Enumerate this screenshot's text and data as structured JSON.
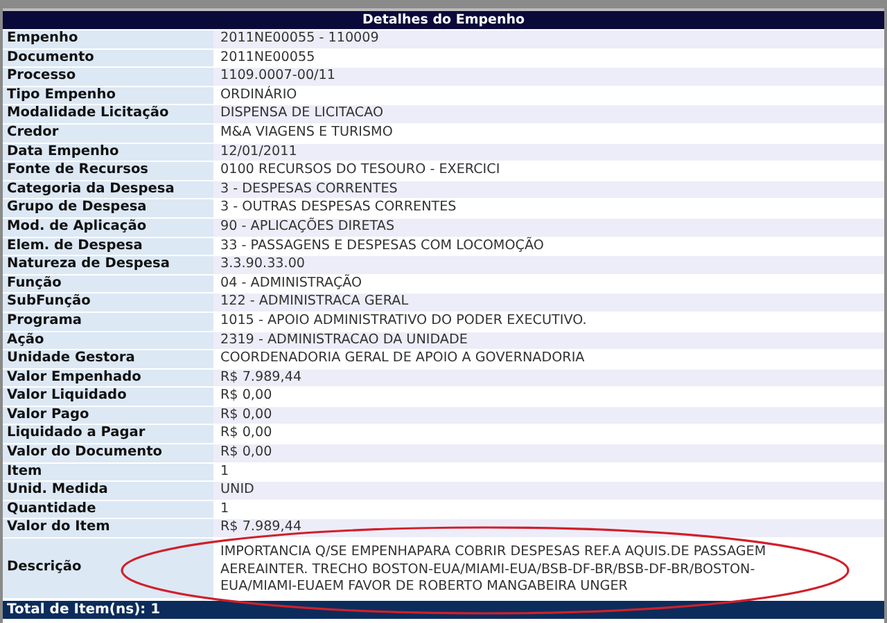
{
  "title": "Detalhes do Empenho",
  "rows": [
    {
      "label": "Empenho",
      "value": "2011NE00055 - 110009"
    },
    {
      "label": "Documento",
      "value": "2011NE00055"
    },
    {
      "label": "Processo",
      "value": "1109.0007-00/11"
    },
    {
      "label": "Tipo Empenho",
      "value": "ORDINÁRIO"
    },
    {
      "label": "Modalidade Licitação",
      "value": "DISPENSA DE LICITACAO"
    },
    {
      "label": "Credor",
      "value": "M&A VIAGENS E TURISMO"
    },
    {
      "label": "Data Empenho",
      "value": "12/01/2011"
    },
    {
      "label": "Fonte de Recursos",
      "value": "0100 RECURSOS DO TESOURO - EXERCICI"
    },
    {
      "label": "Categoria da Despesa",
      "value": "3 - DESPESAS CORRENTES"
    },
    {
      "label": "Grupo de Despesa",
      "value": "3 - OUTRAS DESPESAS CORRENTES"
    },
    {
      "label": "Mod. de Aplicação",
      "value": "90 - APLICAÇÕES DIRETAS"
    },
    {
      "label": "Elem. de Despesa",
      "value": "33 - PASSAGENS E DESPESAS COM LOCOMOÇÃO"
    },
    {
      "label": "Natureza de Despesa",
      "value": "3.3.90.33.00"
    },
    {
      "label": "Função",
      "value": "04 - ADMINISTRAÇÃO"
    },
    {
      "label": "SubFunção",
      "value": "122 - ADMINISTRACA GERAL"
    },
    {
      "label": "Programa",
      "value": "1015 - APOIO ADMINISTRATIVO DO PODER EXECUTIVO."
    },
    {
      "label": "Ação",
      "value": "2319 - ADMINISTRACAO DA UNIDADE"
    },
    {
      "label": "Unidade Gestora",
      "value": "COORDENADORIA GERAL DE APOIO A GOVERNADORIA"
    },
    {
      "label": "Valor Empenhado",
      "value": "R$ 7.989,44"
    },
    {
      "label": "Valor Liquidado",
      "value": "R$ 0,00"
    },
    {
      "label": "Valor Pago",
      "value": "R$ 0,00"
    },
    {
      "label": "Liquidado a Pagar",
      "value": "R$ 0,00"
    },
    {
      "label": "Valor do Documento",
      "value": "R$ 0,00"
    },
    {
      "label": "Item",
      "value": "1"
    },
    {
      "label": "Unid. Medida",
      "value": "UNID"
    },
    {
      "label": "Quantidade",
      "value": "1"
    },
    {
      "label": "Valor do Item",
      "value": "R$ 7.989,44"
    },
    {
      "label": "Descrição",
      "value": "IMPORTANCIA Q/SE EMPENHAPARA COBRIR DESPESAS REF.A AQUIS.DE PASSAGEM AEREAINTER. TRECHO BOSTON-EUA/MIAMI-EUA/BSB-DF-BR/BSB-DF-BR/BOSTON-EUA/MIAMI-EUAEM FAVOR DE ROBERTO MANGABEIRA UNGER"
    }
  ],
  "footer": "Total de Item(ns): 1"
}
